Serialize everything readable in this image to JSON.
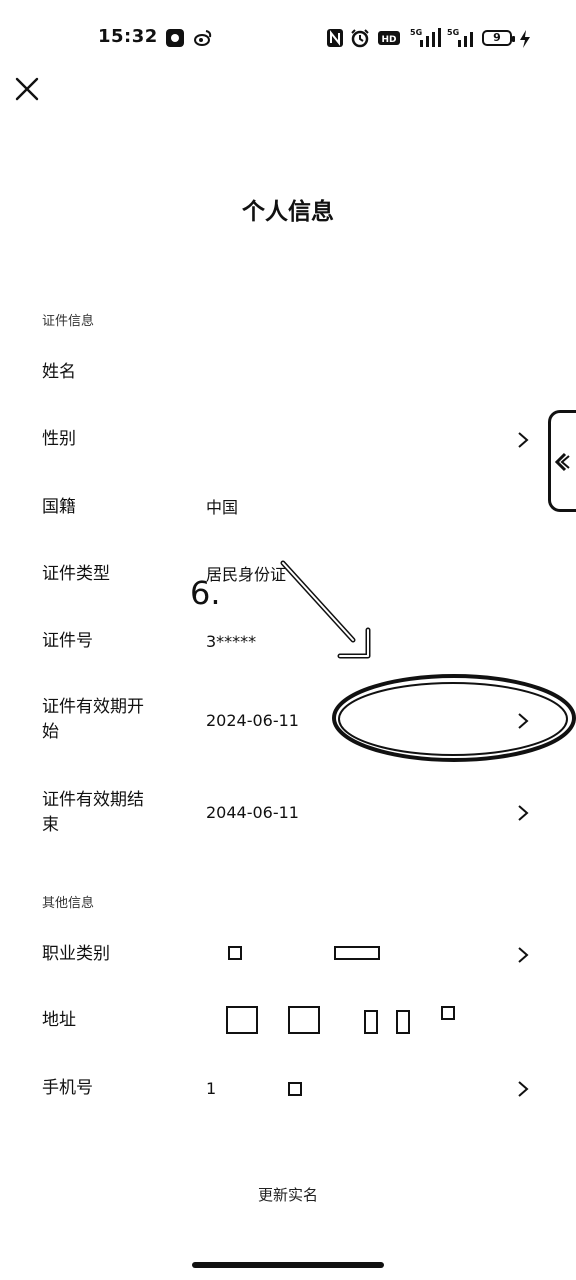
{
  "status_bar": {
    "time": "15:32",
    "battery": "9",
    "network_1": "5G",
    "network_2": "5G",
    "hd_label": "HD",
    "icons": [
      "app-icon",
      "weibo-icon",
      "nfc-icon",
      "alarm-icon",
      "hd-icon",
      "signal-icon",
      "signal-icon",
      "battery-icon",
      "charging-icon"
    ]
  },
  "header": {
    "close_icon": "close-icon",
    "title": "个人信息"
  },
  "sections": {
    "id_info": "证件信息",
    "other_info": "其他信息"
  },
  "id_rows": {
    "name": {
      "label": "姓名",
      "value": ""
    },
    "gender": {
      "label": "性别",
      "value": ""
    },
    "nationality": {
      "label": "国籍",
      "value": "中国"
    },
    "id_type": {
      "label": "证件类型",
      "value": "居民身份证"
    },
    "id_number": {
      "label": "证件号",
      "value": "3*****"
    },
    "valid_start": {
      "label": "证件有效期开始",
      "value": "2024-06-11"
    },
    "valid_end": {
      "label": "证件有效期结束",
      "value": "2044-06-11"
    }
  },
  "other_rows": {
    "occupation": {
      "label": "职业类别",
      "value": ""
    },
    "address": {
      "label": "地址",
      "value": ""
    },
    "phone": {
      "label": "手机号",
      "value": "1"
    }
  },
  "annotation": {
    "step_number": "6."
  },
  "footer": {
    "update_link": "更新实名"
  }
}
